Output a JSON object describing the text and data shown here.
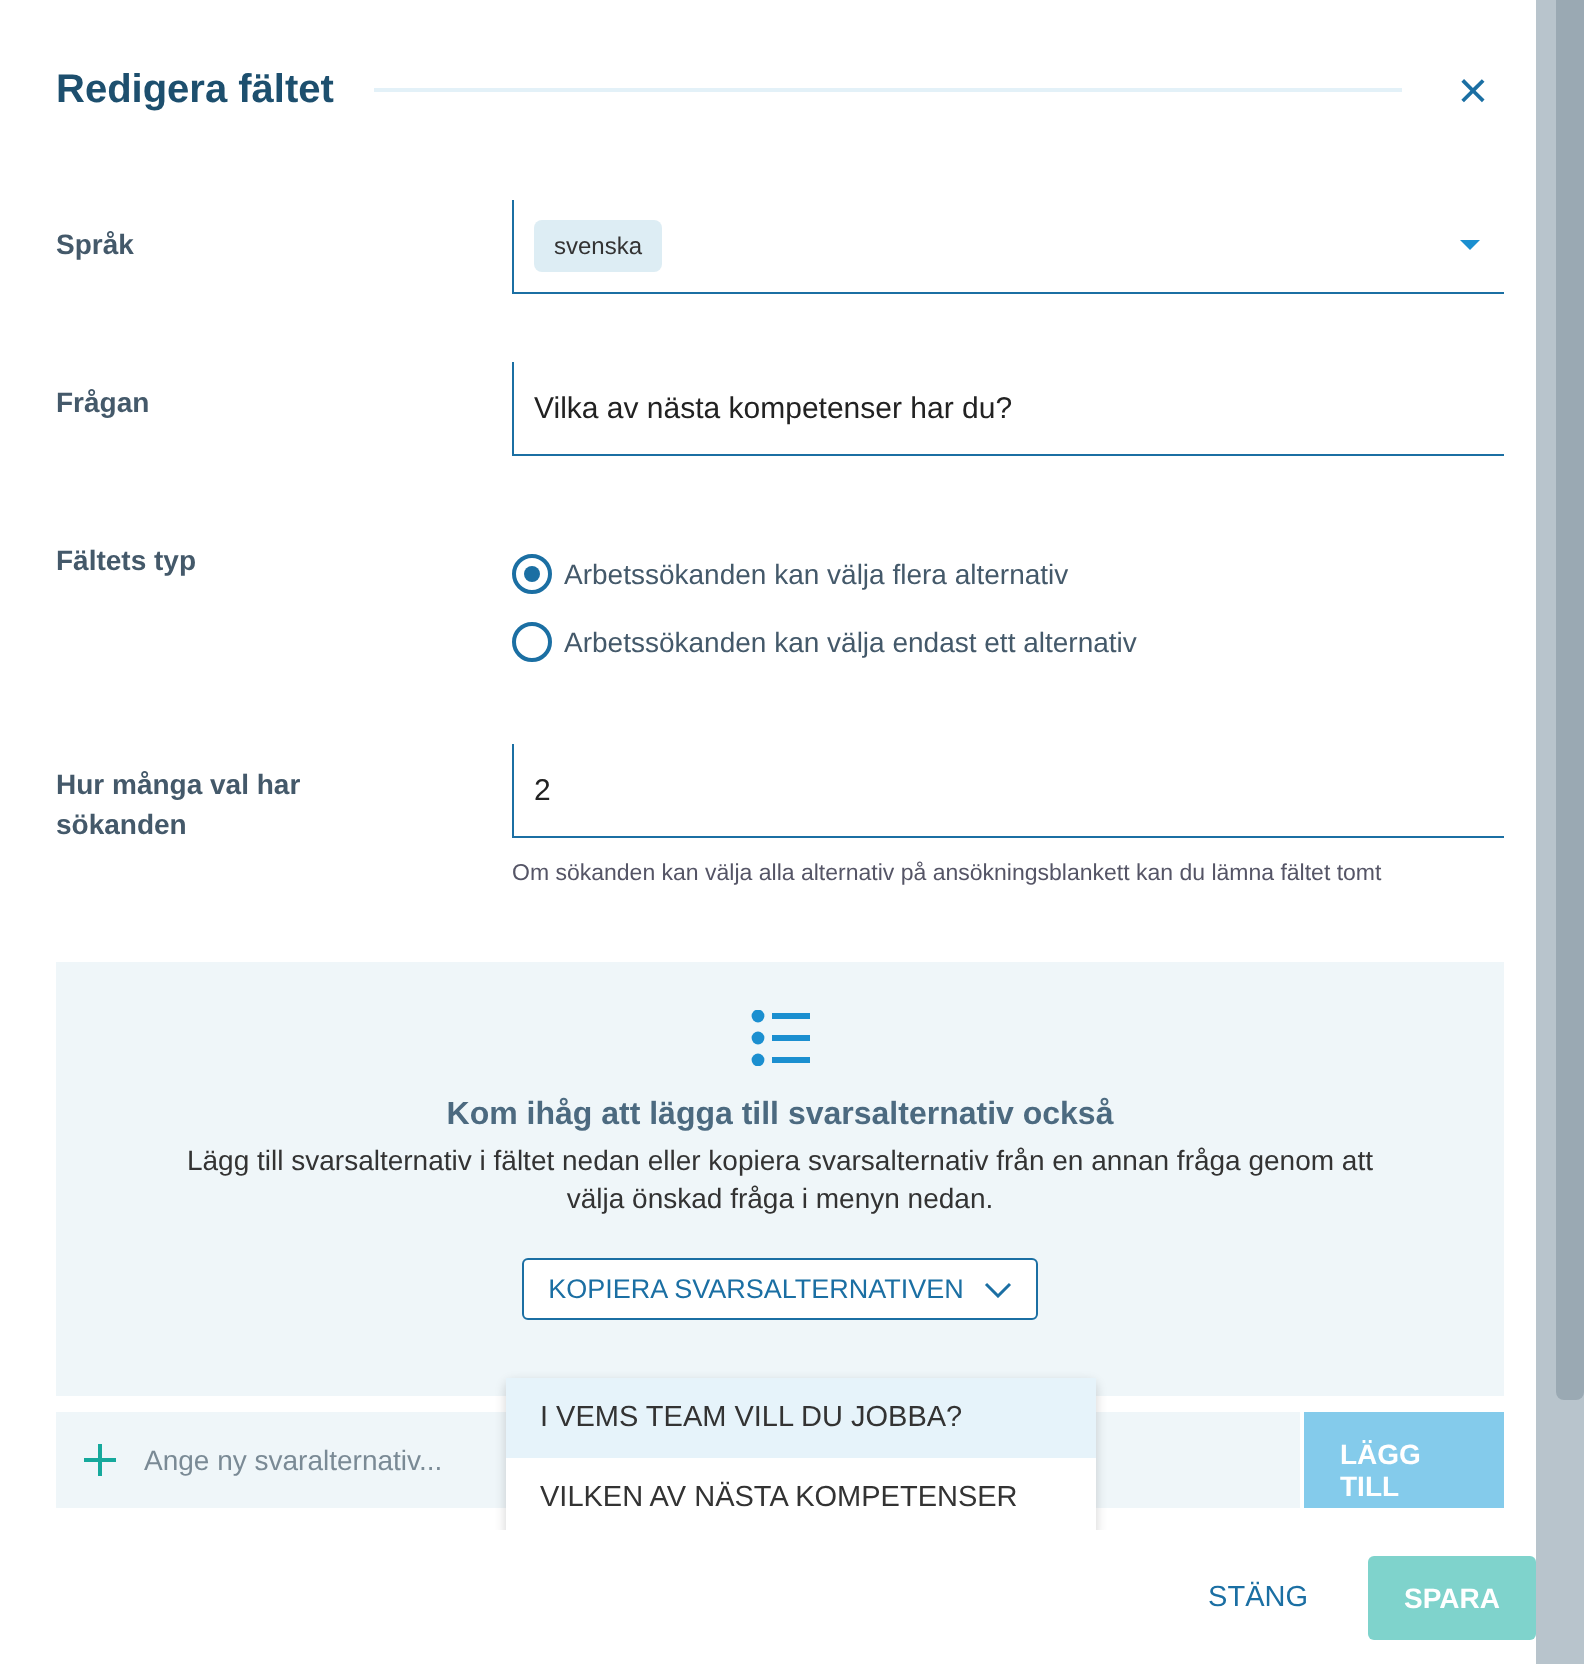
{
  "dialog": {
    "title": "Redigera fältet",
    "close": "×"
  },
  "fields": [
    {
      "kind": "select",
      "label": "Språk",
      "chip": "svenska"
    },
    {
      "kind": "text",
      "label": "Frågan",
      "value": "Vilka av nästa kompetenser har du?"
    },
    {
      "kind": "radio",
      "label": "Fältets typ",
      "options": [
        {
          "label": "Arbetssökanden kan välja flera alternativ",
          "selected": true
        },
        {
          "label": "Arbetssökanden kan välja endast ett alternativ",
          "selected": false
        }
      ]
    },
    {
      "kind": "text",
      "label": "Hur många val har sökanden",
      "value": "2",
      "help": "Om sökanden kan välja alla alternativ på ansökningsblankett kan du lämna fältet tomt"
    }
  ],
  "reminder": {
    "title": "Kom ihåg att lägga till svarsalternativ också",
    "text": "Lägg till svarsalternativ i fältet nedan eller kopiera svarsalternativ från en annan fråga genom att välja önskad fråga i menyn nedan.",
    "copy_button": "KOPIERA SVARSALTERNATIVEN"
  },
  "copy_menu": [
    {
      "label": "I VEMS TEAM VILL DU JOBBA?",
      "selected": true
    },
    {
      "label": "VILKEN AV NÄSTA KOMPETENSER",
      "selected": false
    }
  ],
  "new_option": {
    "placeholder": "Ange ny svaralternativ...",
    "add_button": "LÄGG TILL"
  },
  "footer": {
    "close_button": "STÄNG",
    "save_button": "SPARA"
  }
}
